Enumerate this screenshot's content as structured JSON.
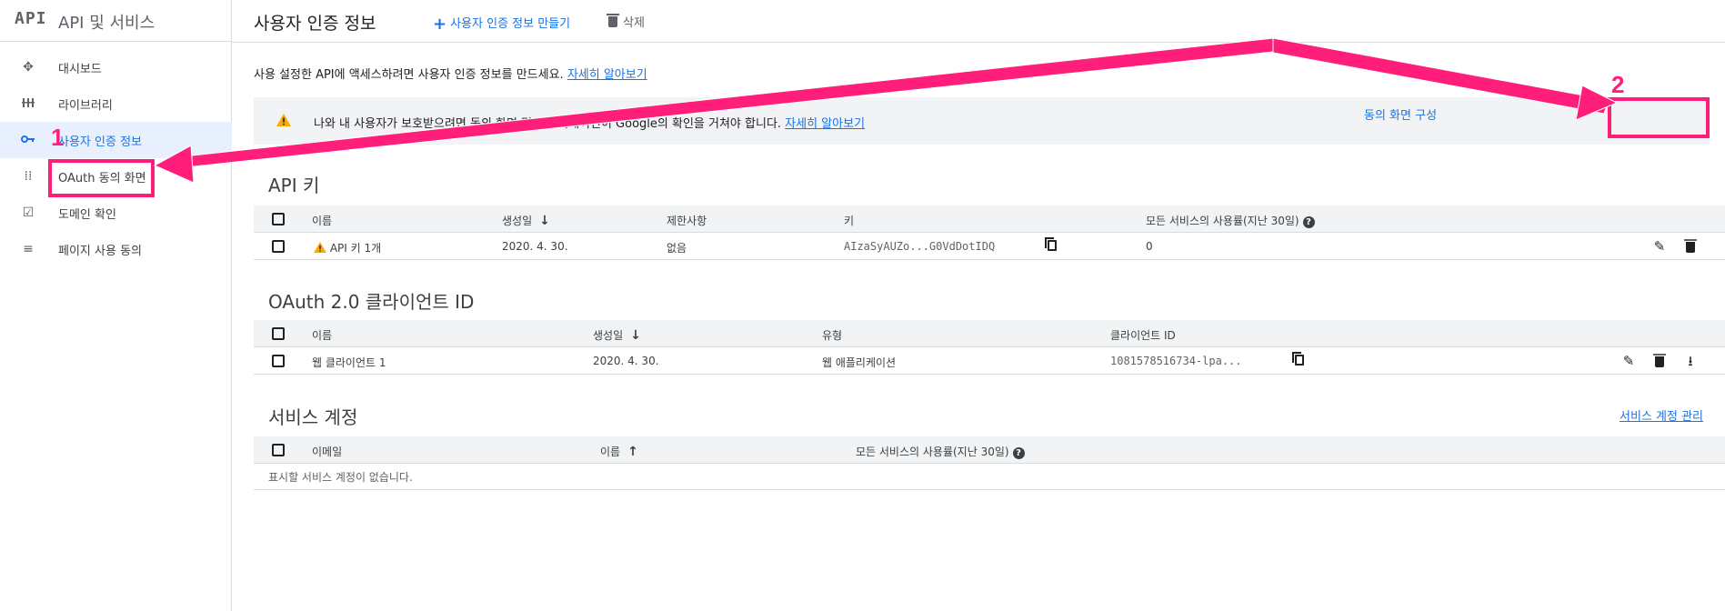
{
  "sidebar": {
    "logo": "API",
    "title": "API 및 서비스",
    "items": [
      {
        "label": "대시보드",
        "icon": "dashboard-icon"
      },
      {
        "label": "라이브러리",
        "icon": "library-icon"
      },
      {
        "label": "사용자 인증 정보",
        "icon": "key-icon"
      },
      {
        "label": "OAuth 동의 화면",
        "icon": "oauth-consent-icon"
      },
      {
        "label": "도메인 확인",
        "icon": "domain-verify-icon"
      },
      {
        "label": "페이지 사용 동의",
        "icon": "page-usage-icon"
      }
    ]
  },
  "header": {
    "title": "사용자 인증 정보",
    "create_label": "사용자 인증 정보 만들기",
    "delete_label": "삭제"
  },
  "intro": {
    "text": "사용 설정한 API에 액세스하려면 사용자 인증 정보를 만드세요.",
    "link": "자세히 알아보기"
  },
  "alert": {
    "text": "나와 내 사용자가 보호받으려면 동의 화면 및 애플리케이션이 Google의 확인을 거쳐야 합니다.",
    "link": "자세히 알아보기",
    "button": "동의 화면 구성"
  },
  "api_keys": {
    "title": "API 키",
    "columns": [
      "이름",
      "생성일",
      "제한사항",
      "키",
      "모든 서비스의 사용률(지난 30일)"
    ],
    "rows": [
      {
        "name": "API 키 1개",
        "created": "2020. 4. 30.",
        "restriction": "없음",
        "key": "AIzaSyAUZo...G0VdDotIDQ",
        "usage": "0"
      }
    ]
  },
  "oauth_clients": {
    "title": "OAuth 2.0 클라이언트 ID",
    "columns": [
      "이름",
      "생성일",
      "유형",
      "클라이언트 ID"
    ],
    "rows": [
      {
        "name": "웹 클라이언트 1",
        "created": "2020. 4. 30.",
        "type": "웹 애플리케이션",
        "client_id": "1081578516734-lpa..."
      }
    ]
  },
  "service_accounts": {
    "title": "서비스 계정",
    "manage_link": "서비스 계정 관리",
    "columns": [
      "이메일",
      "이름",
      "모든 서비스의 사용률(지난 30일)"
    ],
    "empty": "표시할 서비스 계정이 없습니다."
  },
  "annotations": {
    "num1": "1",
    "num2": "2",
    "color": "#ff1f7a"
  },
  "colors": {
    "accent": "#1a73e8",
    "warning": "#f9ab00",
    "annotation": "#ff1f7a"
  }
}
